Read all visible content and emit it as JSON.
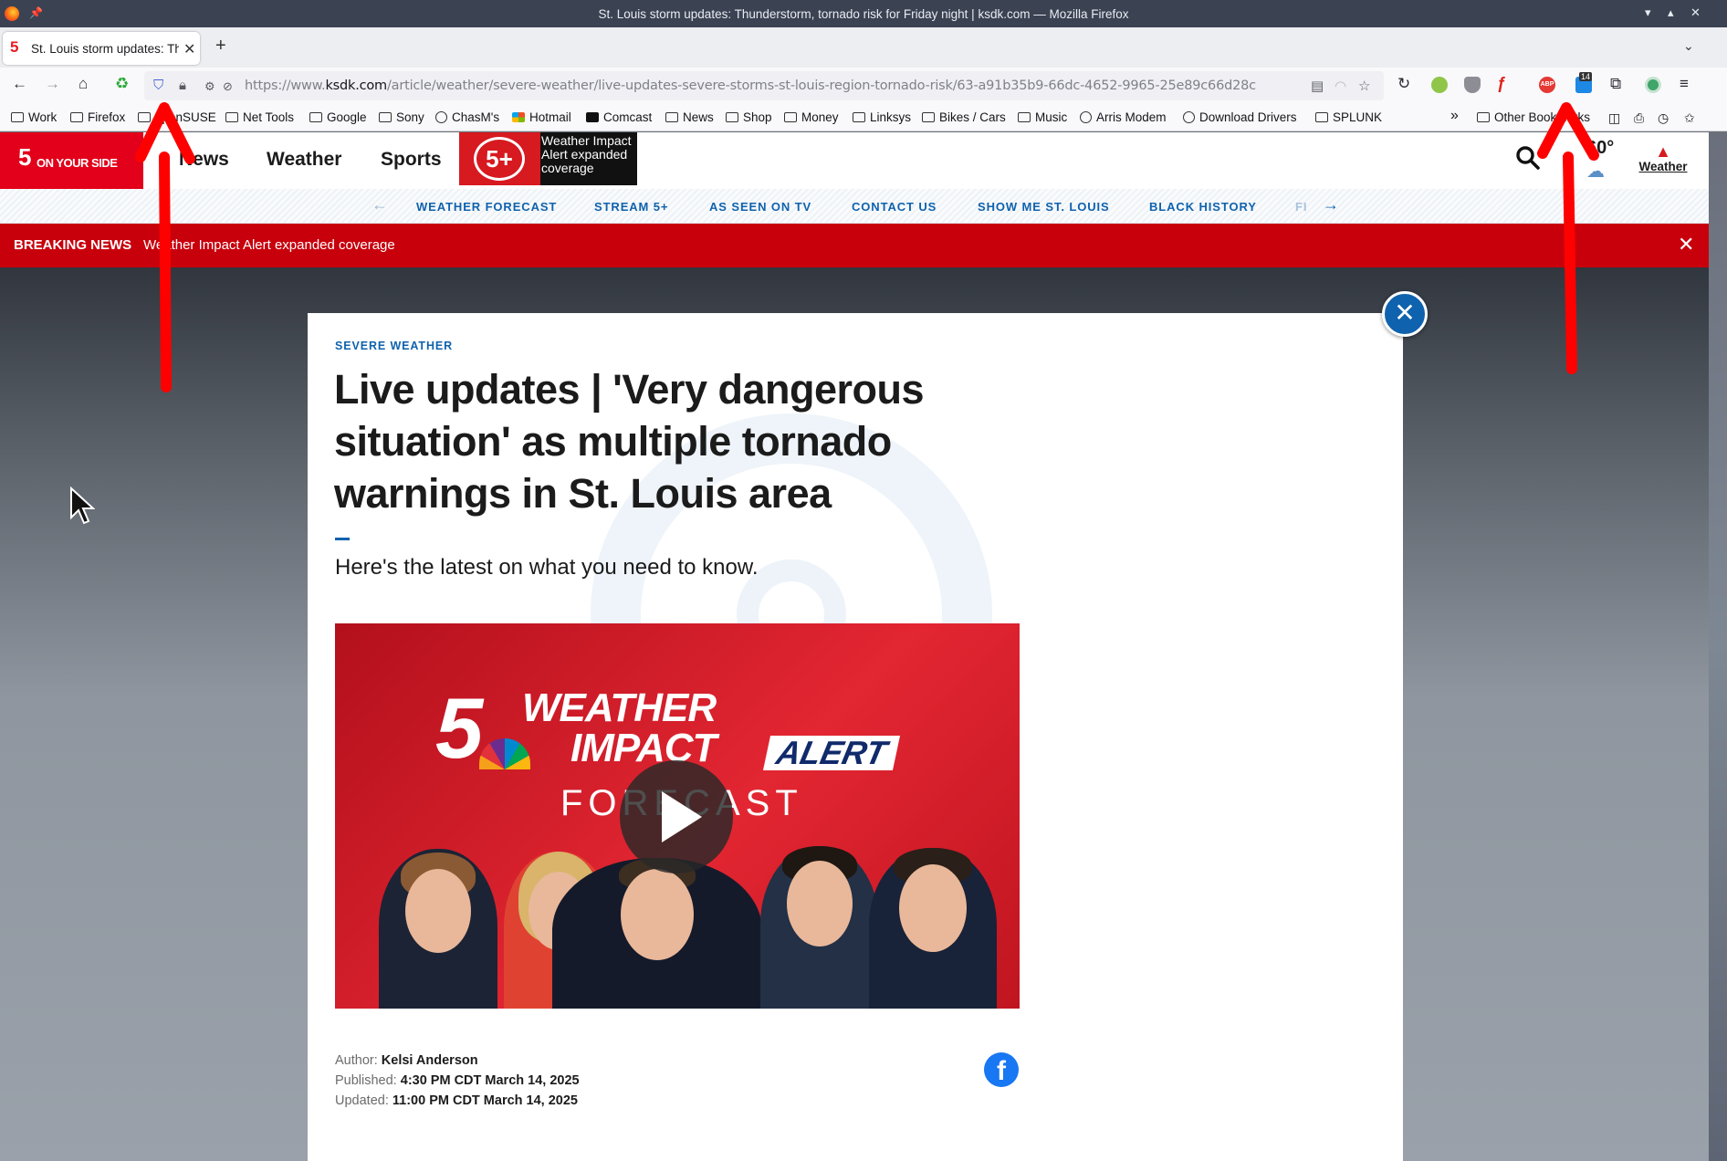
{
  "window": {
    "title": "St. Louis storm updates: Thunderstorm, tornado risk for Friday night | ksdk.com — Mozilla Firefox"
  },
  "tab": {
    "favicon": "5",
    "title": "St. Louis storm updates: Th"
  },
  "urlbar": {
    "scheme": "https://www.",
    "host": "ksdk.com",
    "path": "/article/weather/severe-weather/live-updates-severe-storms-st-louis-region-tornado-risk/63-a91b35b9-66dc-4652-9965-25e89c66d28c"
  },
  "bookmarks": [
    "Work",
    "Firefox",
    "openSUSE",
    "Net Tools",
    "Google",
    "Sony",
    "ChasM's",
    "Hotmail",
    "Comcast",
    "News",
    "Shop",
    "Money",
    "Linksys",
    "Bikes / Cars",
    "Music",
    "Arris Modem",
    "Download Drivers",
    "SPLUNK"
  ],
  "bookmarks_other": "Other Bookmarks",
  "extensions": {
    "badge_count": "14"
  },
  "site": {
    "logo_number": "5",
    "logo_text": "ON YOUR SIDE",
    "nav": [
      "News",
      "Weather",
      "Sports"
    ],
    "fiveplus_logo": "5+",
    "fiveplus_text": "Weather Impact Alert expanded coverage",
    "temperature": "60°",
    "weather_label": "Weather"
  },
  "subnav": [
    "WEATHER FORECAST",
    "STREAM 5+",
    "AS SEEN ON TV",
    "CONTACT US",
    "SHOW ME ST. LOUIS",
    "BLACK HISTORY",
    "FI"
  ],
  "breaking": {
    "label": "BREAKING NEWS",
    "headline": "Weather Impact Alert expanded coverage"
  },
  "article": {
    "kicker": "SEVERE WEATHER",
    "headline": "Live updates | 'Very dangerous situation' as multiple tornado warnings in St. Louis area",
    "dek": "Here's the latest on what you need to know.",
    "video": {
      "number": "5",
      "line1": "WEATHER",
      "line2": "IMPACT",
      "alert": "ALERT",
      "line3": "FORECAST"
    },
    "author_label": "Author:",
    "author": "Kelsi Anderson",
    "published_label": "Published:",
    "published": "4:30 PM CDT March 14, 2025",
    "updated_label": "Updated:",
    "updated": "11:00 PM CDT March 14, 2025"
  },
  "colors": {
    "brand_red": "#e2001a",
    "breaking_red": "#c8000c",
    "link_blue": "#0f62ad",
    "annotation_arrow": "#ff0000"
  }
}
